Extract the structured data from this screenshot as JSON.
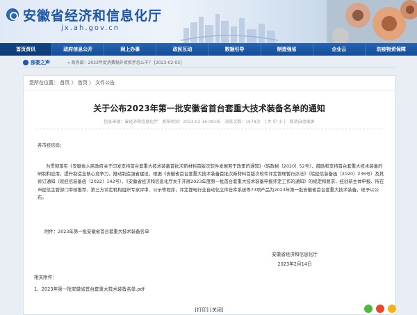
{
  "site": {
    "name": "安徽省经济和信息化厅",
    "domain": "jx.ah.gov.cn"
  },
  "nav": [
    "首页资讯",
    "政府信息公开",
    "网上办事",
    "政民互动",
    "数据引导",
    "制造强省",
    "企业云",
    "防疫物资保障"
  ],
  "news_strip": {
    "label": "部委之声",
    "text": "» 商务部：2023年促消费稳外贸抓手怎么干？ [2023-02-03]"
  },
  "breadcrumb": {
    "prefix": "您所在位置：",
    "items": [
      "首页",
      "首页",
      "文件公告"
    ],
    "sep": " 〉 "
  },
  "article": {
    "title": "关于公布2023年第一批安徽省首台套重大技术装备名单的通知",
    "meta": {
      "source": "信息来源：省经济和信息化厅",
      "date": "发布时间：2023-02-16 08:05",
      "views": "浏览次数：1978次",
      "size": "[ 大  中  小 ]",
      "autoplay": "取消自动滚屏"
    },
    "greeting": "各市经信局：",
    "body": "为贯彻落实《安徽省人民政府关于印发支持首台套重大技术装备首批次新材料首版次软件发展若干政策的通知》（皖政秘〔2020〕52号），鼓励和支持首台套重大技术装备的研制和应用，提升制造业核心竞争力，推动制造强省建设，根据《安徽省首台套重大技术装备首批次新材料首版次软件评定管理暂行办法》（皖经信装备函〔2020〕236号）及其修订通知（皖经信装备函〔2022〕142号）、《安徽省经济和信息化厅关于开展2023年度第一批首台套重大技术装备申报评定工作的通知》的规定和要求，经创新主体申报、所在市经信主管部门审核推荐、第三方评定机构组织专家评审、公示等程序，评定锂电行业自动化立体仓库系统等73项产品为2023年第一批安徽省首台套重大技术装备，现予以公布。",
    "attachment_line": "附件：2023年第一批安徽省首台套重大技术装备名单",
    "signature": {
      "org": "安徽省经济和信息化厅",
      "date": "2023年2月14日"
    },
    "related_label": "相关附件：",
    "related_file": "1、2023年第一批安徽省首台套重大技术装备名单.pdf"
  },
  "actions": {
    "print": "[打印]",
    "close": "[关闭]"
  },
  "share_icons": [
    "wechat-icon",
    "weibo-icon",
    "qzone-icon"
  ],
  "colors": {
    "brand": "#1c56a4",
    "nav": "#1c5aa6"
  }
}
